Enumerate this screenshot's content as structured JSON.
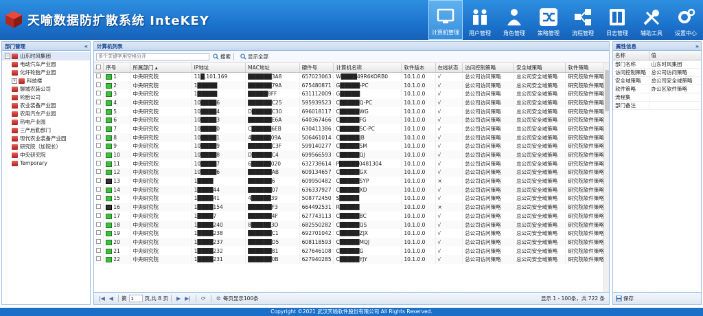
{
  "header": {
    "title": "天喻数据防扩散系统 InteKEY"
  },
  "nav": [
    {
      "label": "计算机管理",
      "icon": "computer-icon",
      "active": true
    },
    {
      "label": "用户管理",
      "icon": "users-icon",
      "active": false
    },
    {
      "label": "角色管理",
      "icon": "role-icon",
      "active": false
    },
    {
      "label": "策略管理",
      "icon": "shuffle-icon",
      "active": false
    },
    {
      "label": "流程管理",
      "icon": "flow-icon",
      "active": false
    },
    {
      "label": "日志管理",
      "icon": "book-icon",
      "active": false
    },
    {
      "label": "辅助工具",
      "icon": "tools-icon",
      "active": false
    },
    {
      "label": "设置中心",
      "icon": "gear-icon",
      "active": false
    }
  ],
  "left": {
    "title": "部门管理",
    "tree": [
      {
        "label": "山东时风集团",
        "level": 0,
        "expander": "−",
        "icon": "org-icon",
        "selected": true
      },
      {
        "label": "电动汽车产业园",
        "level": 1,
        "expander": "",
        "icon": "dept-icon"
      },
      {
        "label": "化纤轮胎产业园",
        "level": 1,
        "expander": "",
        "icon": "dept-icon"
      },
      {
        "label": "科技楼",
        "level": 1,
        "expander": "+",
        "icon": "dept-icon"
      },
      {
        "label": "聊城农装公司",
        "level": 1,
        "expander": "",
        "icon": "dept-icon"
      },
      {
        "label": "轮胎公司",
        "level": 1,
        "expander": "",
        "icon": "dept-icon"
      },
      {
        "label": "农业装备产业园",
        "level": 1,
        "expander": "",
        "icon": "dept-icon"
      },
      {
        "label": "农用汽车产业园",
        "level": 1,
        "expander": "",
        "icon": "dept-icon"
      },
      {
        "label": "热电产业园",
        "level": 1,
        "expander": "",
        "icon": "dept-icon"
      },
      {
        "label": "三产后勤部门",
        "level": 1,
        "expander": "",
        "icon": "dept-icon"
      },
      {
        "label": "现代农业装备产业园",
        "level": 1,
        "expander": "",
        "icon": "dept-icon"
      },
      {
        "label": "研究院（加院长）",
        "level": 1,
        "expander": "",
        "icon": "dept-icon"
      },
      {
        "label": "中央研究院",
        "level": 1,
        "expander": "",
        "icon": "dept-icon"
      },
      {
        "label": "Temporary",
        "level": 0,
        "expander": "",
        "icon": "org-icon"
      }
    ]
  },
  "center": {
    "title": "计算机列表",
    "search_placeholder": "多个关键字用空格分开",
    "search_label": "搜索",
    "showall_label": "显示全部",
    "columns": [
      "序号",
      "所属部门 ▴",
      "IP地址",
      "MAC地址",
      "硬件号",
      "计算机名称",
      "软件版本",
      "在线状态",
      "访问控制策略",
      "安全域策略",
      "软件策略"
    ],
    "rows": [
      {
        "n": "1",
        "dept": "中央研究院",
        "ip": "11█.101.169",
        "mac": "██████3A8",
        "hw": "657023063",
        "name": "W████49R6KORB0",
        "ver": "10.1.0.0",
        "st": "√",
        "acl": "总公司访问策略",
        "sec": "总公司安全域策略",
        "sw": "研究院软件策略",
        "on": true
      },
      {
        "n": "2",
        "dept": "中央研究院",
        "ip": "1█████",
        "mac": "██████79A",
        "hw": "675480871",
        "name": "G█████-PC",
        "ver": "10.1.0.0",
        "st": "√",
        "acl": "总公司访问策略",
        "sec": "总公司安全域策略",
        "sw": "研究院软件策略",
        "on": true
      },
      {
        "n": "3",
        "dept": "中央研究院",
        "ip": "1█████",
        "mac": "█████8FF",
        "hw": "631112009",
        "name": "G█████",
        "ver": "10.1.0.0",
        "st": "√",
        "acl": "总公司访问策略",
        "sec": "总公司安全域策略",
        "sw": "研究院软件策略",
        "on": true
      },
      {
        "n": "4",
        "dept": "中央研究院",
        "ip": "10████6",
        "mac": "██████C25",
        "hw": "595939523",
        "name": "C█████Q-PC",
        "ver": "10.1.0.0",
        "st": "√",
        "acl": "总公司访问策略",
        "sec": "总公司安全域策略",
        "sw": "研究院软件策略",
        "on": true
      },
      {
        "n": "5",
        "dept": "中央研究院",
        "ip": "10████4",
        "mac": "D█████C30",
        "hw": "696018117",
        "name": "C█████WG",
        "ver": "10.1.0.0",
        "st": "√",
        "acl": "总公司访问策略",
        "sec": "总公司安全域策略",
        "sw": "研究院软件策略",
        "on": true
      },
      {
        "n": "6",
        "dept": "中央研究院",
        "ip": "10████3",
        "mac": "██████E6A",
        "hw": "640367466",
        "name": "C█████FG",
        "ver": "10.1.0.0",
        "st": "√",
        "acl": "总公司访问策略",
        "sec": "总公司安全域策略",
        "sw": "研究院软件策略",
        "on": true
      },
      {
        "n": "7",
        "dept": "中央研究院",
        "ip": "10████0",
        "mac": "C█████6EB",
        "hw": "630411386",
        "name": "C█████SC-PC",
        "ver": "10.1.0.0",
        "st": "√",
        "acl": "总公司访问策略",
        "sec": "总公司安全域策略",
        "sw": "研究院软件策略",
        "on": true
      },
      {
        "n": "8",
        "dept": "中央研究院",
        "ip": "10████1",
        "mac": "4█████09A",
        "hw": "506461014",
        "name": "C█████JB",
        "ver": "10.1.0.0",
        "st": "√",
        "acl": "总公司访问策略",
        "sec": "总公司安全域策略",
        "sw": "研究院软件策略",
        "on": true
      },
      {
        "n": "9",
        "dept": "中央研究院",
        "ip": "10████9",
        "mac": "██████C3F",
        "hw": "599140277",
        "name": "C█████SM",
        "ver": "10.1.0.0",
        "st": "√",
        "acl": "总公司访问策略",
        "sec": "总公司安全域策略",
        "sw": "研究院软件策略",
        "on": true
      },
      {
        "n": "10",
        "dept": "中央研究院",
        "ip": "10████8",
        "mac": "D█████C4",
        "hw": "699566593",
        "name": "C█████QJ",
        "ver": "10.1.0.0",
        "st": "√",
        "acl": "总公司访问策略",
        "sec": "总公司安全域策略",
        "sw": "研究院软件策略",
        "on": true
      },
      {
        "n": "11",
        "dept": "中央研究院",
        "ip": "10████7",
        "mac": "6█████020",
        "hw": "632738614",
        "name": "P█████0481304",
        "ver": "10.1.0.0",
        "st": "√",
        "acl": "总公司访问策略",
        "sec": "总公司安全域策略",
        "sw": "研究院软件策略",
        "on": true
      },
      {
        "n": "12",
        "dept": "中央研究院",
        "ip": "10████6",
        "mac": "██████AB",
        "hw": "609134657",
        "name": "C█████GX",
        "ver": "10.1.0.0",
        "st": "√",
        "acl": "总公司访问策略",
        "sec": "总公司安全域策略",
        "sw": "研究院软件策略",
        "on": true
      },
      {
        "n": "13",
        "dept": "中央研究院",
        "ip": "1████",
        "mac": "██████6",
        "hw": "609950482",
        "name": "C█████SYP",
        "ver": "10.1.0.0",
        "st": "×",
        "acl": "总公司访问策略",
        "sec": "总公司安全域策略",
        "sw": "研究院软件策略",
        "on": false
      },
      {
        "n": "14",
        "dept": "中央研究院",
        "ip": "1████44",
        "mac": "██████07",
        "hw": "636337927",
        "name": "C█████XD",
        "ver": "10.1.0.0",
        "st": "√",
        "acl": "总公司访问策略",
        "sec": "总公司安全域策略",
        "sw": "研究院软件策略",
        "on": true
      },
      {
        "n": "15",
        "dept": "中央研究院",
        "ip": "1████41",
        "mac": "4█████39",
        "hw": "508772450",
        "name": "S█████",
        "ver": "10.1.0.0",
        "st": "√",
        "acl": "总公司访问策略",
        "sec": "总公司安全域策略",
        "sw": "研究院软件策略",
        "on": true
      },
      {
        "n": "16",
        "dept": "中央研究院",
        "ip": "1████154",
        "mac": "██████F3",
        "hw": "664492531",
        "name": "R█████",
        "ver": "10.1.0.0",
        "st": "×",
        "acl": "总公司访问策略",
        "sec": "总公司安全域策略",
        "sw": "研究院软件策略",
        "on": false
      },
      {
        "n": "17",
        "dept": "中央研究院",
        "ip": "1████7",
        "mac": "██████4F",
        "hw": "627743113",
        "name": "C█████BC",
        "ver": "10.1.0.0",
        "st": "√",
        "acl": "总公司访问策略",
        "sec": "总公司安全域策略",
        "sw": "研究院软件策略",
        "on": true
      },
      {
        "n": "18",
        "dept": "中央研究院",
        "ip": "1████240",
        "mac": "8█████3D",
        "hw": "682550282",
        "name": "C█████QS",
        "ver": "10.1.0.0",
        "st": "√",
        "acl": "总公司访问策略",
        "sec": "总公司安全域策略",
        "sw": "研究院软件策略",
        "on": true
      },
      {
        "n": "19",
        "dept": "中央研究院",
        "ip": "1████238",
        "mac": "██████C1",
        "hw": "692701042",
        "name": "C█████ZJX",
        "ver": "10.1.0.0",
        "st": "√",
        "acl": "总公司访问策略",
        "sec": "总公司安全域策略",
        "sw": "研究院软件策略",
        "on": true
      },
      {
        "n": "20",
        "dept": "中央研究院",
        "ip": "1████237",
        "mac": "██████D5",
        "hw": "608118593",
        "name": "C█████MQJ",
        "ver": "10.1.0.0",
        "st": "√",
        "acl": "总公司访问策略",
        "sec": "总公司安全域策略",
        "sw": "研究院软件策略",
        "on": true
      },
      {
        "n": "21",
        "dept": "中央研究院",
        "ip": "1████232",
        "mac": "██████81",
        "hw": "627646108",
        "name": "C█████G",
        "ver": "10.1.0.0",
        "st": "√",
        "acl": "总公司访问策略",
        "sec": "总公司安全域策略",
        "sw": "研究院软件策略",
        "on": true
      },
      {
        "n": "22",
        "dept": "中央研究院",
        "ip": "1████231",
        "mac": "██████0B",
        "hw": "627940285",
        "name": "C█████YJY",
        "ver": "10.1.0.0",
        "st": "√",
        "acl": "总公司访问策略",
        "sec": "总公司安全域策略",
        "sw": "研究院软件策略",
        "on": true
      }
    ],
    "pager": {
      "page_prefix": "第",
      "page_value": "1",
      "page_suffix": "页,共 8 页",
      "page_size": "每页显示100条",
      "display": "显示 1 - 100条，共 722 条"
    }
  },
  "right": {
    "title": "属性信息",
    "head_name": "名称",
    "head_value": "值",
    "props": [
      [
        "部门名称",
        "山东时风集团"
      ],
      [
        "访问控制策略",
        "总公司访问策略"
      ],
      [
        "安全域策略",
        "总公司安全域策略"
      ],
      [
        "软件策略",
        "办公区软件策略"
      ],
      [
        "流程集",
        ""
      ],
      [
        "部门备注",
        ""
      ]
    ],
    "save_label": "保存"
  },
  "footer": {
    "text": "Copyright ©2021 武汉天喻软件股份有限公司 All Rights Reserved."
  }
}
